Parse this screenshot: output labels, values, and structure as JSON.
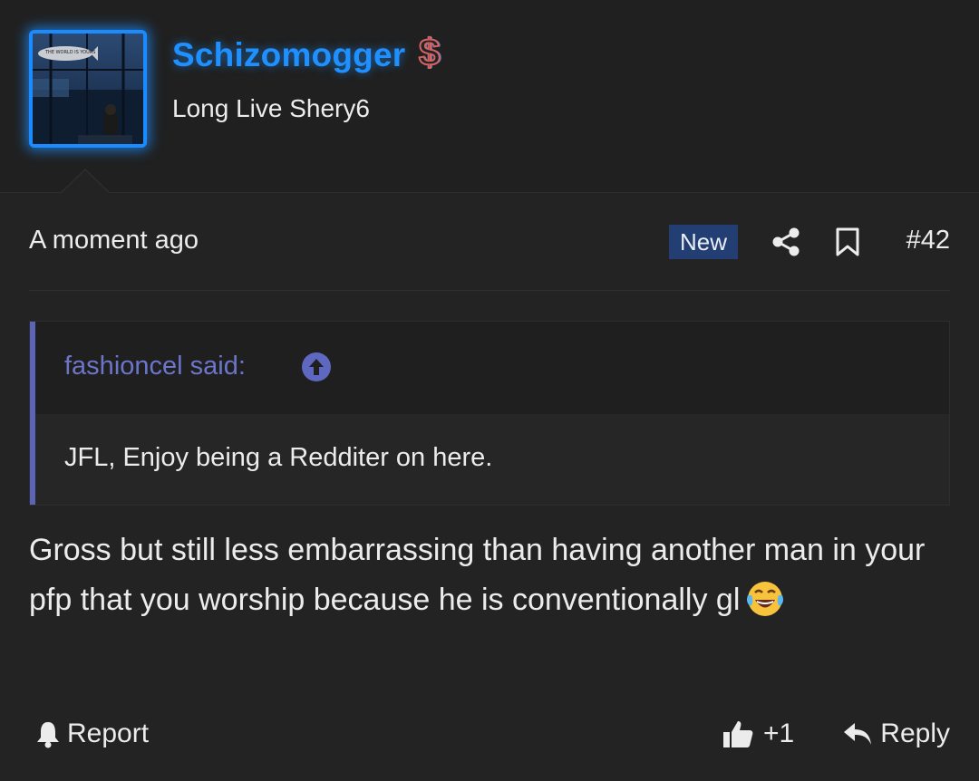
{
  "user": {
    "name": "Schizomogger",
    "title": "Long Live Shery6",
    "badge_icon": "dollar-sign-icon",
    "name_color": "#1e90ff"
  },
  "avatar": {
    "blimp_text": "THE WORLD IS YOURS"
  },
  "post": {
    "timestamp": "A moment ago",
    "new_badge": "New",
    "number": "#42",
    "share_icon": "share-icon",
    "bookmark_icon": "bookmark-icon",
    "body": "Gross but still less embarrassing than having another man in your pfp that you worship because he is conventionally gl",
    "emoji": "face-with-tears-of-joy"
  },
  "quote": {
    "author_said": "fashioncel said:",
    "text": "JFL, Enjoy being a Redditer on here.",
    "accent_color": "#5c64b8"
  },
  "actions": {
    "report": "Report",
    "like_count": "+1",
    "reply": "Reply"
  }
}
